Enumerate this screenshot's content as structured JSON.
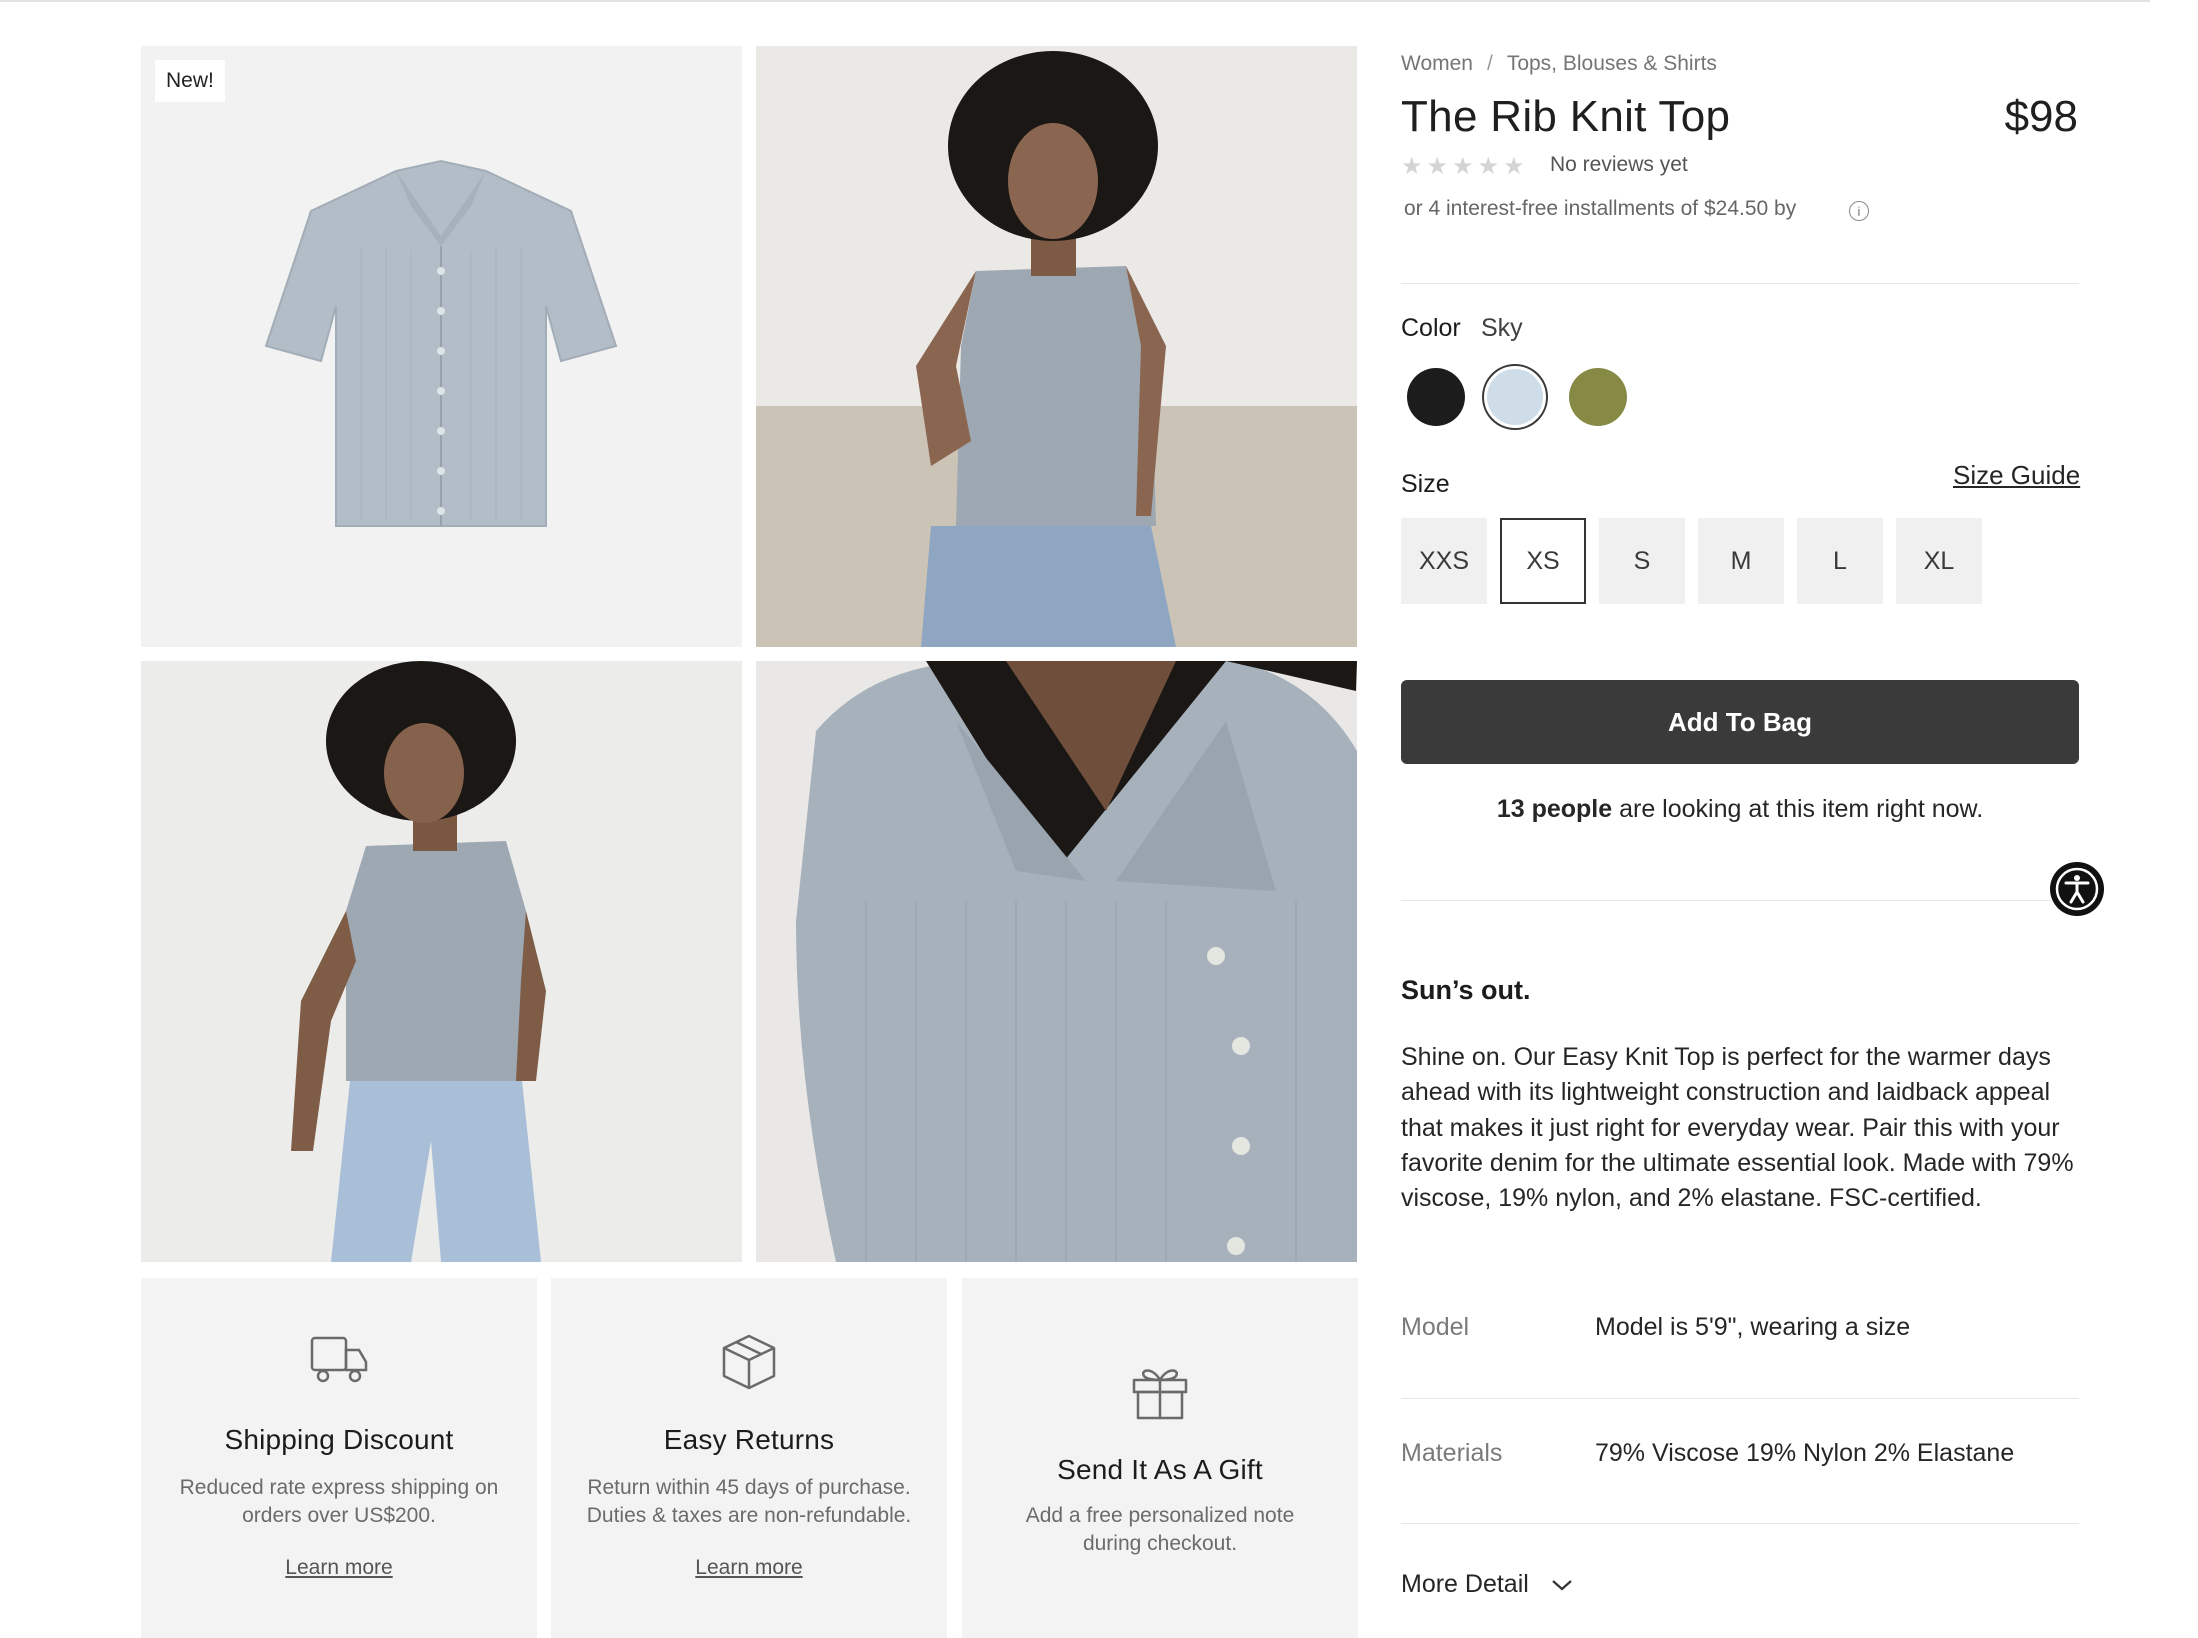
{
  "badge": "New!",
  "breadcrumb": {
    "items": [
      "Women",
      "Tops, Blouses & Shirts"
    ],
    "separator": "/"
  },
  "product": {
    "title": "The Rib Knit Top",
    "price": "$98",
    "reviews_text": "No reviews yet",
    "rating": 0,
    "installments": "or 4 interest-free installments of $24.50 by",
    "color_label": "Color",
    "color_value": "Sky",
    "swatches": [
      {
        "name": "black",
        "color": "#1c1c1c",
        "selected": false
      },
      {
        "name": "sky",
        "color": "#cfdde8",
        "selected": true
      },
      {
        "name": "olive",
        "color": "#868a45",
        "selected": false
      }
    ],
    "size_label": "Size",
    "size_guide": "Size Guide",
    "sizes": [
      "XXS",
      "XS",
      "S",
      "M",
      "L",
      "XL"
    ],
    "selected_size": "XS",
    "add_to_bag": "Add To Bag",
    "looking_count": "13 people",
    "looking_text": " are looking at this item right now."
  },
  "description": {
    "heading": "Sun’s out.",
    "body": "Shine on. Our Easy Knit Top is perfect for the warmer days ahead with its lightweight construction and laidback appeal that makes it just right for everyday wear. Pair this with your favorite denim for the ultimate essential look. Made with 79% viscose, 19% nylon, and 2% elastane. FSC-certified."
  },
  "details": [
    {
      "key": "Model",
      "value": "Model is 5'9\", wearing a size"
    },
    {
      "key": "Materials",
      "value": "79% Viscose 19% Nylon 2% Elastane"
    }
  ],
  "more_detail": "More Detail",
  "features": [
    {
      "icon": "truck-icon",
      "title": "Shipping Discount",
      "text": "Reduced rate express shipping on orders over US$200.",
      "link": "Learn more"
    },
    {
      "icon": "box-icon",
      "title": "Easy Returns",
      "text": "Return within 45 days of purchase. Duties & taxes are non-refundable.",
      "link": "Learn more"
    },
    {
      "icon": "gift-icon",
      "title": "Send It As A Gift",
      "text": "Add a free personalized note during checkout.",
      "link": ""
    }
  ],
  "colors": {
    "button": "#3a3a3a",
    "star_empty": "#d4d4d4",
    "card_bg": "#f3f3f3"
  }
}
